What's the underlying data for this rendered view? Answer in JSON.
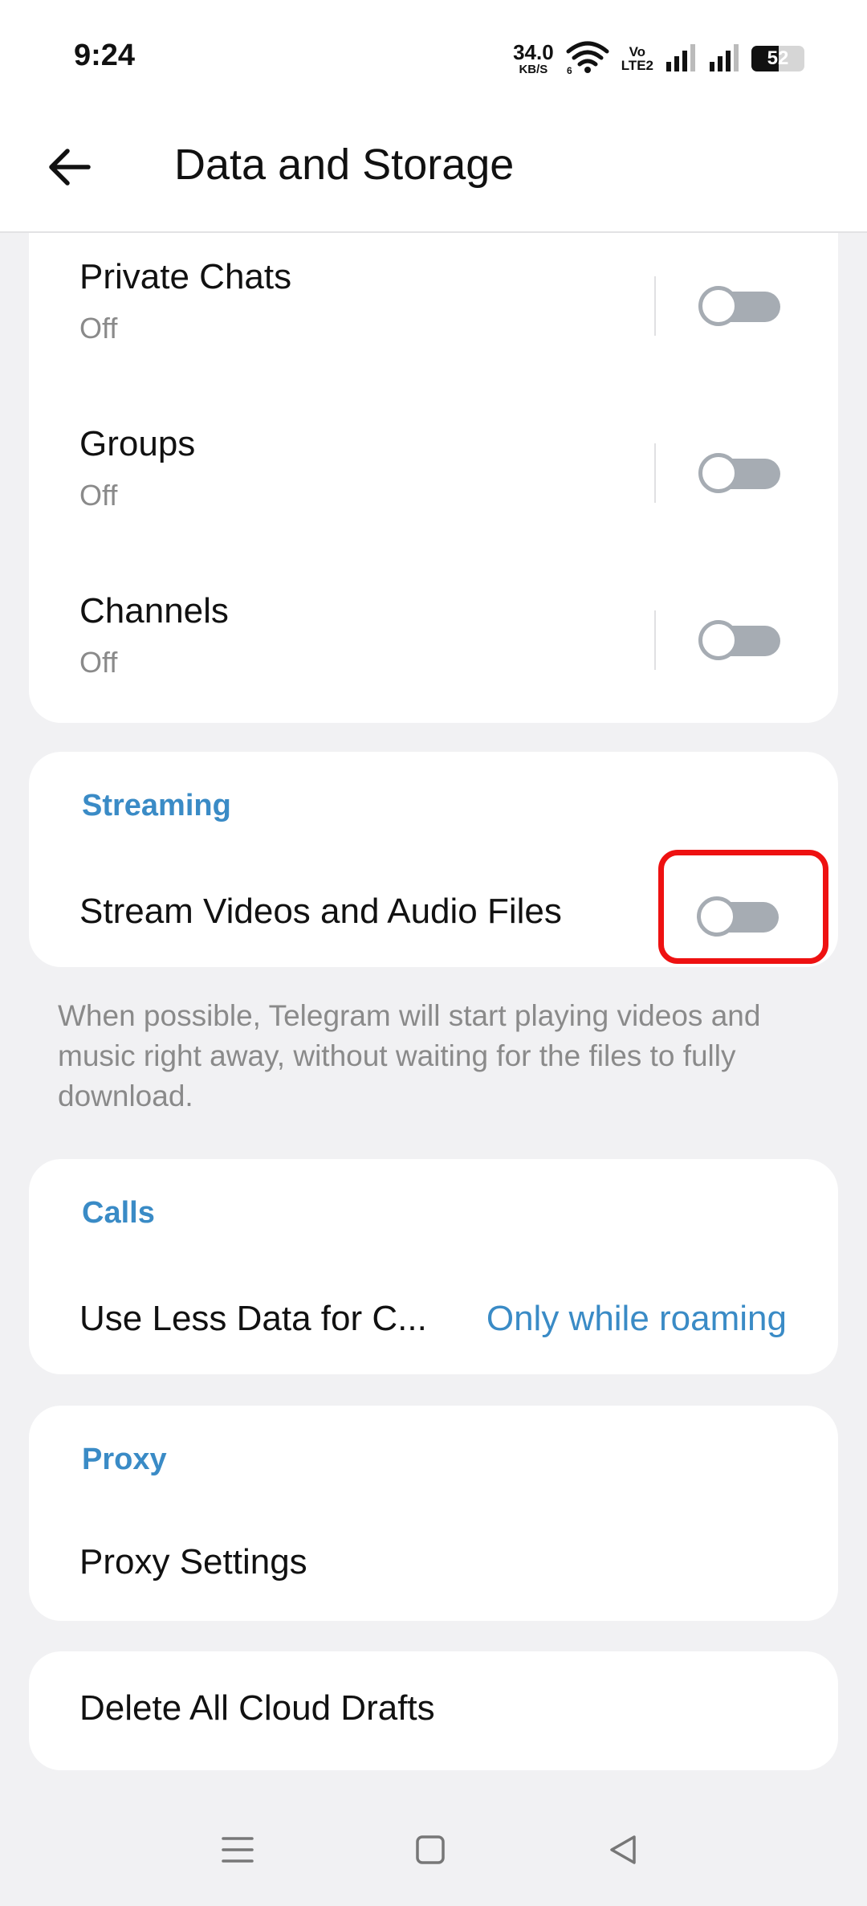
{
  "status_bar": {
    "time": "9:24",
    "net_speed_value": "34.0",
    "net_speed_unit": "KB/S",
    "volte_top": "Vo",
    "volte_bottom": "LTE2",
    "battery_level": "52",
    "battery_fraction": 0.52
  },
  "header": {
    "title": "Data and Storage",
    "back_icon": "arrow-left-icon"
  },
  "auto_download": {
    "items": [
      {
        "title": "Private Chats",
        "subtitle": "Off",
        "enabled": false
      },
      {
        "title": "Groups",
        "subtitle": "Off",
        "enabled": false
      },
      {
        "title": "Channels",
        "subtitle": "Off",
        "enabled": false
      }
    ]
  },
  "streaming": {
    "header": "Streaming",
    "item_title": "Stream Videos and Audio Files",
    "enabled": false,
    "info": "When possible, Telegram will start playing videos and music right away, without waiting for the files to fully download."
  },
  "calls": {
    "header": "Calls",
    "item_title": "Use Less Data for C...",
    "item_value": "Only while roaming"
  },
  "proxy": {
    "header": "Proxy",
    "item_title": "Proxy Settings"
  },
  "drafts": {
    "item_title": "Delete All Cloud Drafts"
  },
  "colors": {
    "accent": "#3a8bc6",
    "highlight": "#ee1111",
    "switch_off": "#a6acb3",
    "background": "#f1f1f3"
  },
  "nav_bar": {
    "menu_icon": "menu-icon",
    "home_icon": "home-square-icon",
    "back_icon": "back-triangle-icon"
  }
}
